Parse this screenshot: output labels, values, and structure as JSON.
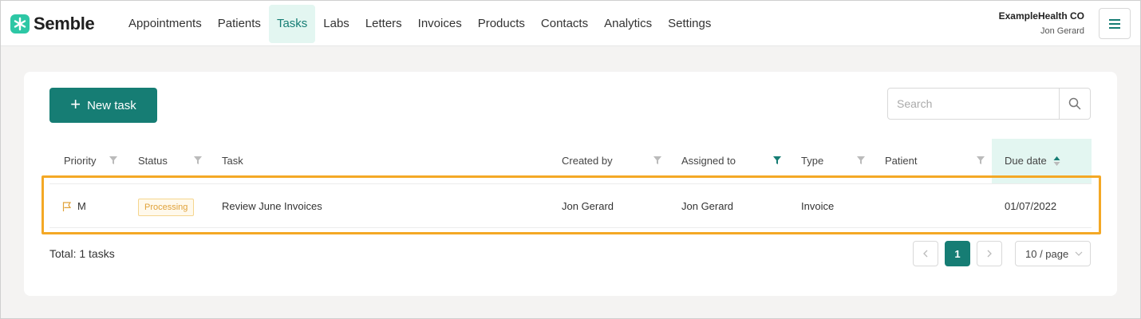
{
  "app": {
    "name": "Semble"
  },
  "nav": {
    "items": [
      {
        "label": "Appointments"
      },
      {
        "label": "Patients"
      },
      {
        "label": "Tasks",
        "active": true
      },
      {
        "label": "Labs"
      },
      {
        "label": "Letters"
      },
      {
        "label": "Invoices"
      },
      {
        "label": "Products"
      },
      {
        "label": "Contacts"
      },
      {
        "label": "Analytics"
      },
      {
        "label": "Settings"
      }
    ]
  },
  "account": {
    "org": "ExampleHealth CO",
    "user": "Jon Gerard"
  },
  "toolbar": {
    "new_task_label": "New task",
    "search_placeholder": "Search"
  },
  "table": {
    "columns": [
      "Priority",
      "Status",
      "Task",
      "Created by",
      "Assigned to",
      "Type",
      "Patient",
      "Due date"
    ],
    "rows": [
      {
        "priority": "M",
        "status": "Processing",
        "task": "Review June Invoices",
        "created_by": "Jon Gerard",
        "assigned_to": "Jon Gerard",
        "type": "Invoice",
        "patient": "",
        "due_date": "01/07/2022"
      }
    ]
  },
  "footer": {
    "total": "Total: 1 tasks",
    "current_page": "1",
    "page_size": "10 / page"
  },
  "colors": {
    "brand": "#167d74",
    "accent_bg": "#e3f6f1",
    "highlight": "#f4a825",
    "status_processing": "#e0a23a"
  },
  "icons": [
    "logo-icon",
    "menu-icon",
    "plus-icon",
    "search-icon",
    "filter-icon",
    "sort-icon",
    "flag-icon",
    "chevron-left-icon",
    "chevron-right-icon",
    "chevron-down-icon"
  ]
}
